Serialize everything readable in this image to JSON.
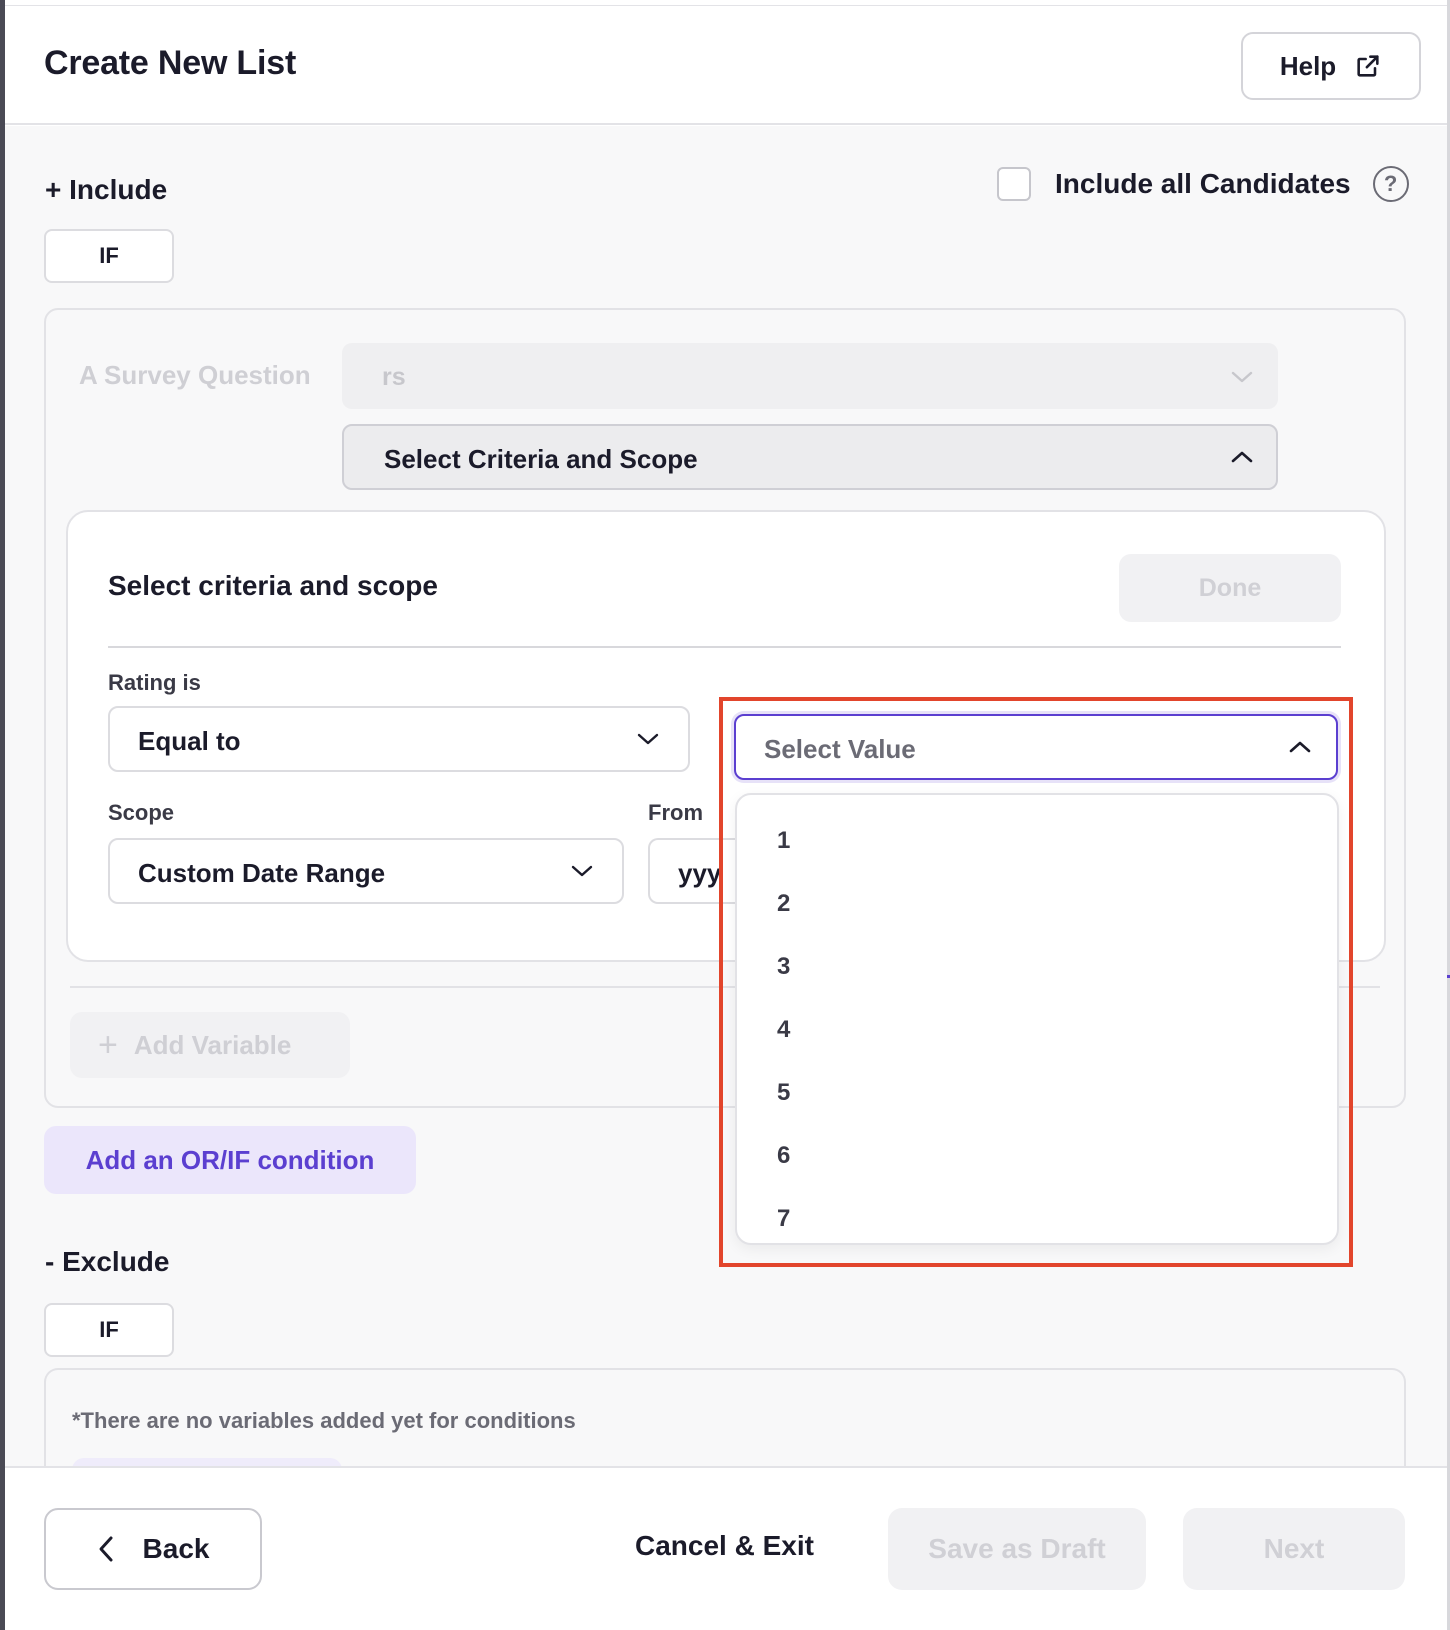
{
  "header": {
    "title": "Create New List",
    "help_label": "Help",
    "help_icon": "external-link-icon"
  },
  "include": {
    "title": "+ Include",
    "include_all_label": "Include all Candidates",
    "include_all_checked": false,
    "if_label": "IF"
  },
  "condition": {
    "survey_label": "A Survey Question",
    "survey_value": "rs",
    "criteria_bar_label": "Select Criteria and Scope",
    "panel": {
      "title": "Select criteria and scope",
      "done_label": "Done",
      "rating_label": "Rating is",
      "operator_value": "Equal to",
      "value_placeholder": "Select Value",
      "scope_label": "Scope",
      "scope_value": "Custom Date Range",
      "from_label": "From",
      "from_placeholder": "yyy"
    },
    "add_variable_label": "Add Variable"
  },
  "dropdown": {
    "options": [
      "1",
      "2",
      "3",
      "4",
      "5",
      "6",
      "7"
    ]
  },
  "or_if_label": "Add an OR/IF condition",
  "exclude": {
    "title": "- Exclude",
    "if_label": "IF",
    "empty_text": "*There are no variables added yet for conditions"
  },
  "footer": {
    "back_label": "Back",
    "cancel_label": "Cancel & Exit",
    "draft_label": "Save as Draft",
    "next_label": "Next"
  },
  "colors": {
    "accent": "#5B3FD0",
    "highlight_outline": "#E2452C",
    "disabled_text": "#D0D0D5"
  }
}
